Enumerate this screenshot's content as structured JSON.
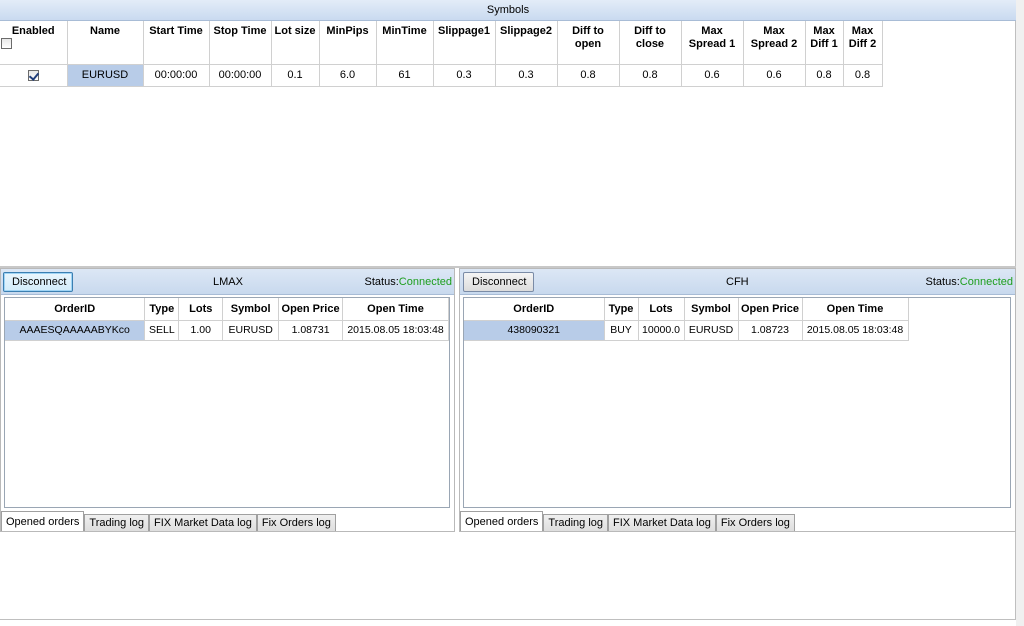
{
  "symbols": {
    "title": "Symbols",
    "columns": [
      "Enabled",
      "Name",
      "Start Time",
      "Stop Time",
      "Lot size",
      "MinPips",
      "MinTime",
      "Slippage1",
      "Slippage2",
      "Diff to open",
      "Diff to close",
      "Max Spread 1",
      "Max Spread 2",
      "Max Diff 1",
      "Max Diff 2"
    ],
    "rows": [
      {
        "enabled": true,
        "name": "EURUSD",
        "start_time": "00:00:00",
        "stop_time": "00:00:00",
        "lot_size": "0.1",
        "min_pips": "6.0",
        "min_time": "61",
        "slippage1": "0.3",
        "slippage2": "0.3",
        "diff_to_open": "0.8",
        "diff_to_close": "0.8",
        "max_spread1": "0.6",
        "max_spread2": "0.6",
        "max_diff1": "0.8",
        "max_diff2": "0.8"
      }
    ]
  },
  "panels": [
    {
      "disconnect_label": "Disconnect",
      "title": "LMAX",
      "status_label": "Status:",
      "status_value": "Connected",
      "columns": [
        "OrderID",
        "Type",
        "Lots",
        "Symbol",
        "Open Price",
        "Open Time"
      ],
      "rows": [
        {
          "order_id": "AAAESQAAAAABYKco",
          "type": "SELL",
          "lots": "1.00",
          "symbol": "EURUSD",
          "open_price": "1.08731",
          "open_time": "2015.08.05 18:03:48"
        }
      ],
      "tabs": [
        "Opened orders",
        "Trading log",
        "FIX Market Data log",
        "Fix Orders log"
      ]
    },
    {
      "disconnect_label": "Disconnect",
      "title": "CFH",
      "status_label": "Status:",
      "status_value": "Connected",
      "columns": [
        "OrderID",
        "Type",
        "Lots",
        "Symbol",
        "Open Price",
        "Open Time"
      ],
      "rows": [
        {
          "order_id": "438090321",
          "type": "BUY",
          "lots": "10000.0",
          "symbol": "EURUSD",
          "open_price": "1.08723",
          "open_time": "2015.08.05 18:03:48"
        }
      ],
      "tabs": [
        "Opened orders",
        "Trading log",
        "FIX Market Data log",
        "Fix Orders log"
      ]
    }
  ],
  "colors": {
    "status_connected": "#1e9e1e",
    "selection": "#b8cce8",
    "header_bg": "#c9daf0"
  }
}
